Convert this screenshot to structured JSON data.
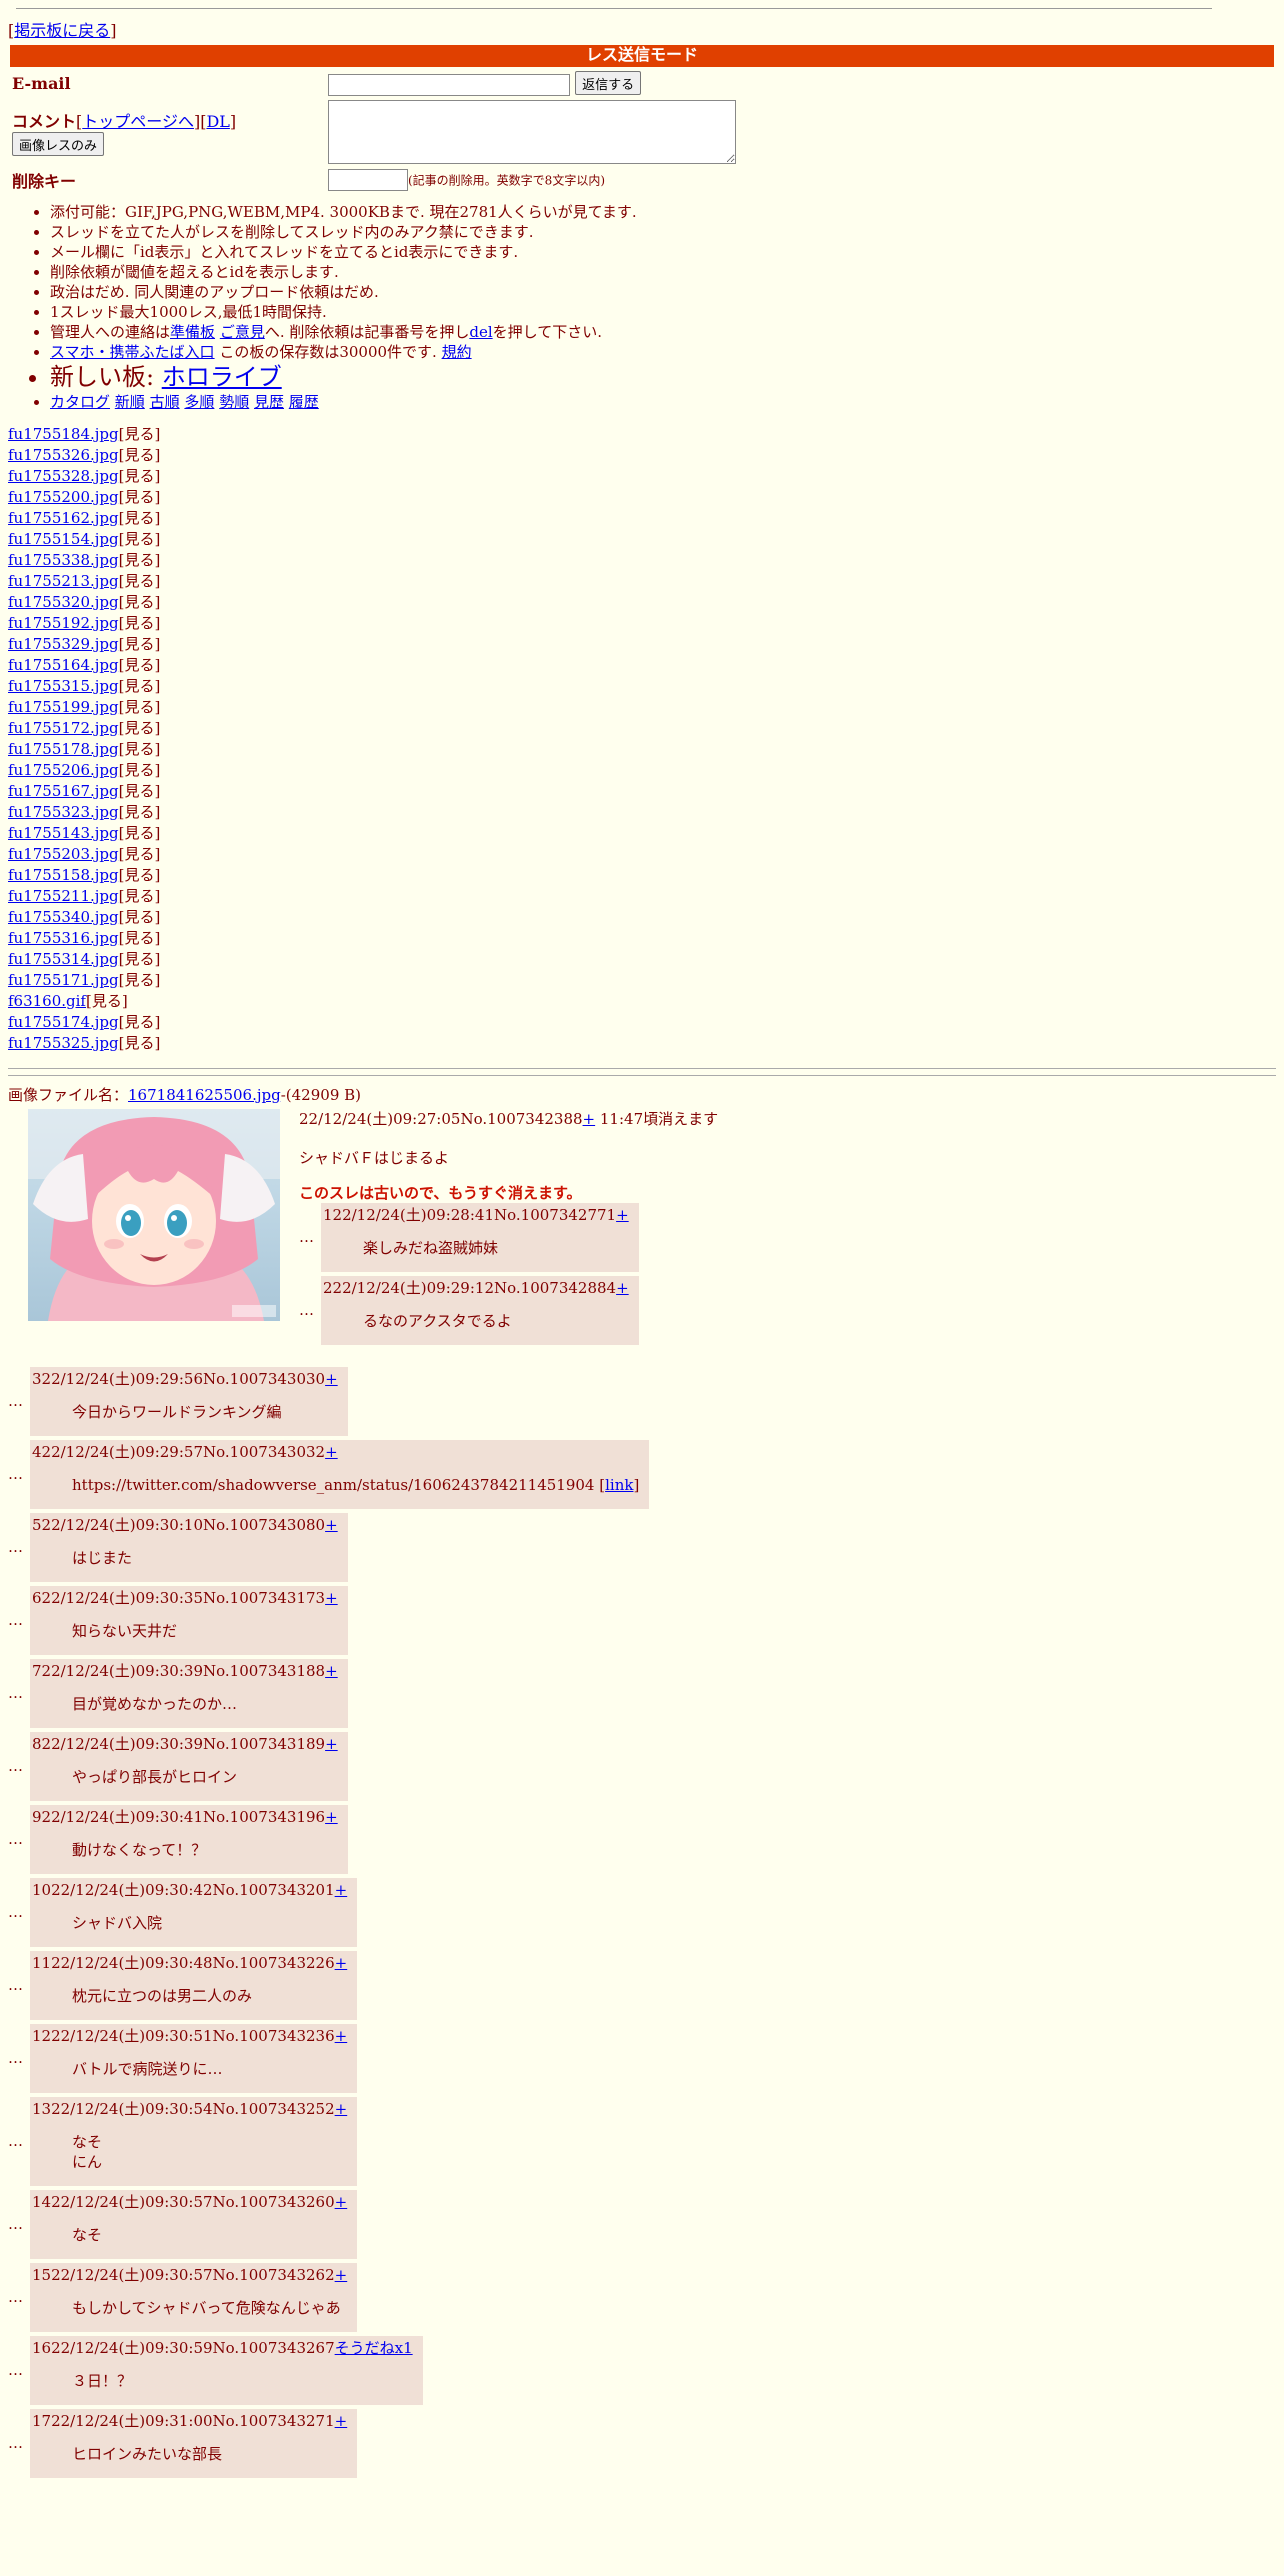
{
  "nav": {
    "back_label": "掲示板に戻る"
  },
  "mode_title": "レス送信モード",
  "form": {
    "email_label": "E-mail",
    "submit_label": "返信する",
    "comment_label": "コメント",
    "top_link": "トップページへ",
    "dl_link": "DL",
    "image_only_label": "画像レスのみ",
    "delkey_label": "削除キー",
    "delkey_note": "(記事の削除用。英数字で8文字以内)"
  },
  "rules": [
    "添付可能：GIF,JPG,PNG,WEBM,MP4. 3000KBまで. 現在2781人くらいが見てます.",
    "スレッドを立てた人がレスを削除してスレッド内のみアク禁にできます.",
    "メール欄に「id表示」と入れてスレッドを立てるとid表示にできます.",
    "削除依頼が閾値を超えるとidを表示します.",
    "政治はだめ. 同人関連のアップロード依頼はだめ.",
    "1スレッド最大1000レス,最低1時間保持."
  ],
  "rule_contact": {
    "prefix": "管理人への連絡は",
    "link1": "準備板",
    "link2": "ご意見",
    "middle": "へ. 削除依頼は記事番号を押し",
    "del": "del",
    "suffix": "を押して下さい."
  },
  "rule_mobile": {
    "link": "スマホ・携帯ふたば入口",
    "text": " この板の保存数は30000件です. ",
    "terms": "規約"
  },
  "rule_newboard": {
    "prefix": "新しい板: ",
    "link": "ホロライブ"
  },
  "rule_catalog": [
    "カタログ",
    "新順",
    "古順",
    "多順",
    "勢順",
    "見歴",
    "履歴"
  ],
  "files": [
    "fu1755184.jpg",
    "fu1755326.jpg",
    "fu1755328.jpg",
    "fu1755200.jpg",
    "fu1755162.jpg",
    "fu1755154.jpg",
    "fu1755338.jpg",
    "fu1755213.jpg",
    "fu1755320.jpg",
    "fu1755192.jpg",
    "fu1755329.jpg",
    "fu1755164.jpg",
    "fu1755315.jpg",
    "fu1755199.jpg",
    "fu1755172.jpg",
    "fu1755178.jpg",
    "fu1755206.jpg",
    "fu1755167.jpg",
    "fu1755323.jpg",
    "fu1755143.jpg",
    "fu1755203.jpg",
    "fu1755158.jpg",
    "fu1755211.jpg",
    "fu1755340.jpg",
    "fu1755316.jpg",
    "fu1755314.jpg",
    "fu1755171.jpg",
    "f63160.gif",
    "fu1755174.jpg",
    "fu1755325.jpg"
  ],
  "view_label": "[見る]",
  "op": {
    "file_prefix": "画像ファイル名：",
    "file_name": "1671841625506.jpg",
    "file_size": "-(42909 B)",
    "header": "22/12/24(土)09:27:05No.1007342388",
    "expiry": " 11:47頃消えます",
    "message": "シャドバＦはじまるよ",
    "warning": "このスレは古いので、もうすぐ消えます。",
    "plus": "+"
  },
  "dots": "…",
  "replies_inline": [
    {
      "header": "122/12/24(土)09:28:41No.1007342771",
      "plus": "+",
      "text": "楽しみだね盗賊姉妹"
    },
    {
      "header": "222/12/24(土)09:29:12No.1007342884",
      "plus": "+",
      "text": "るなのアクスタでるよ"
    }
  ],
  "replies": [
    {
      "header": "322/12/24(土)09:29:56No.1007343030",
      "plus": "+",
      "text": "今日からワールドランキング編"
    },
    {
      "header": "422/12/24(土)09:29:57No.1007343032",
      "plus": "+",
      "text": "https://twitter.com/shadowverse_anm/status/1606243784211451904 [",
      "link": "link",
      "tail": "]"
    },
    {
      "header": "522/12/24(土)09:30:10No.1007343080",
      "plus": "+",
      "text": "はじまた"
    },
    {
      "header": "622/12/24(土)09:30:35No.1007343173",
      "plus": "+",
      "text": "知らない天井だ"
    },
    {
      "header": "722/12/24(土)09:30:39No.1007343188",
      "plus": "+",
      "text": "目が覚めなかったのか…"
    },
    {
      "header": "822/12/24(土)09:30:39No.1007343189",
      "plus": "+",
      "text": "やっぱり部長がヒロイン"
    },
    {
      "header": "922/12/24(土)09:30:41No.1007343196",
      "plus": "+",
      "text": "動けなくなって！？"
    },
    {
      "header": "1022/12/24(土)09:30:42No.1007343201",
      "plus": "+",
      "text": "シャドバ入院"
    },
    {
      "header": "1122/12/24(土)09:30:48No.1007343226",
      "plus": "+",
      "text": "枕元に立つのは男二人のみ"
    },
    {
      "header": "1222/12/24(土)09:30:51No.1007343236",
      "plus": "+",
      "text": "バトルで病院送りに…"
    },
    {
      "header": "1322/12/24(土)09:30:54No.1007343252",
      "plus": "+",
      "text": "なそ",
      "text2": "にん"
    },
    {
      "header": "1422/12/24(土)09:30:57No.1007343260",
      "plus": "+",
      "text": "なそ"
    },
    {
      "header": "1522/12/24(土)09:30:57No.1007343262",
      "plus": "+",
      "text": "もしかしてシャドバって危険なんじゃあ"
    },
    {
      "header": "1622/12/24(土)09:30:59No.1007343267",
      "plus": "そうだねx1",
      "text": "３日！？"
    },
    {
      "header": "1722/12/24(土)09:31:00No.1007343271",
      "plus": "+",
      "text": "ヒロインみたいな部長"
    }
  ]
}
